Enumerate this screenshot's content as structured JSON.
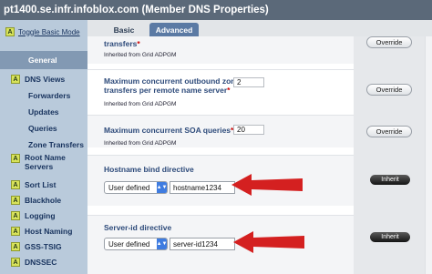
{
  "window": {
    "title": "pt1400.se.infr.infoblox.com (Member DNS Properties)"
  },
  "sidebar": {
    "toggle_label": "Toggle Basic Mode",
    "items": [
      {
        "label": "General",
        "selected": true,
        "icon": null
      },
      {
        "label": "DNS Views",
        "icon": "A"
      },
      {
        "label": "Forwarders",
        "icon": null
      },
      {
        "label": "Updates",
        "icon": null
      },
      {
        "label": "Queries",
        "icon": null
      },
      {
        "label": "Zone Transfers",
        "icon": null
      },
      {
        "label": "Root Name",
        "label2": "Servers",
        "icon": "A"
      },
      {
        "label": "Sort List",
        "icon": "A"
      },
      {
        "label": "Blackhole",
        "icon": "A"
      },
      {
        "label": "Logging",
        "icon": "A"
      },
      {
        "label": "Host Naming",
        "icon": "A"
      },
      {
        "label": "GSS-TSIG",
        "icon": "A"
      },
      {
        "label": "DNSSEC",
        "icon": "A"
      }
    ]
  },
  "tabs": {
    "basic": "Basic",
    "advanced": "Advanced",
    "active": "Advanced"
  },
  "fields": {
    "transfers": {
      "label": "transfers",
      "inherited": "Inherited from Grid ADPGM",
      "button": "Override"
    },
    "max_transfers": {
      "label_line1": "Maximum concurrent outbound zone",
      "label_line2": "transfers per remote name server",
      "value": "2",
      "inherited": "Inherited from Grid ADPGM",
      "button": "Override"
    },
    "max_soa": {
      "label": "Maximum concurrent SOA queries",
      "value": "20",
      "inherited": "Inherited from Grid ADPGM",
      "button": "Override"
    },
    "hostname_bind": {
      "label": "Hostname bind directive",
      "select_value": "User defined",
      "input_value": "hostname1234",
      "button": "Inherit"
    },
    "server_id": {
      "label": "Server-id directive",
      "select_value": "User defined",
      "input_value": "server-id1234",
      "button": "Inherit"
    }
  },
  "colors": {
    "titlebar": "#5b6979",
    "sidebar": "#b9cadb",
    "selected": "#8299b3",
    "tab_active": "#5b7aa4",
    "arrow": "#d42020",
    "required": "#cc0000"
  }
}
